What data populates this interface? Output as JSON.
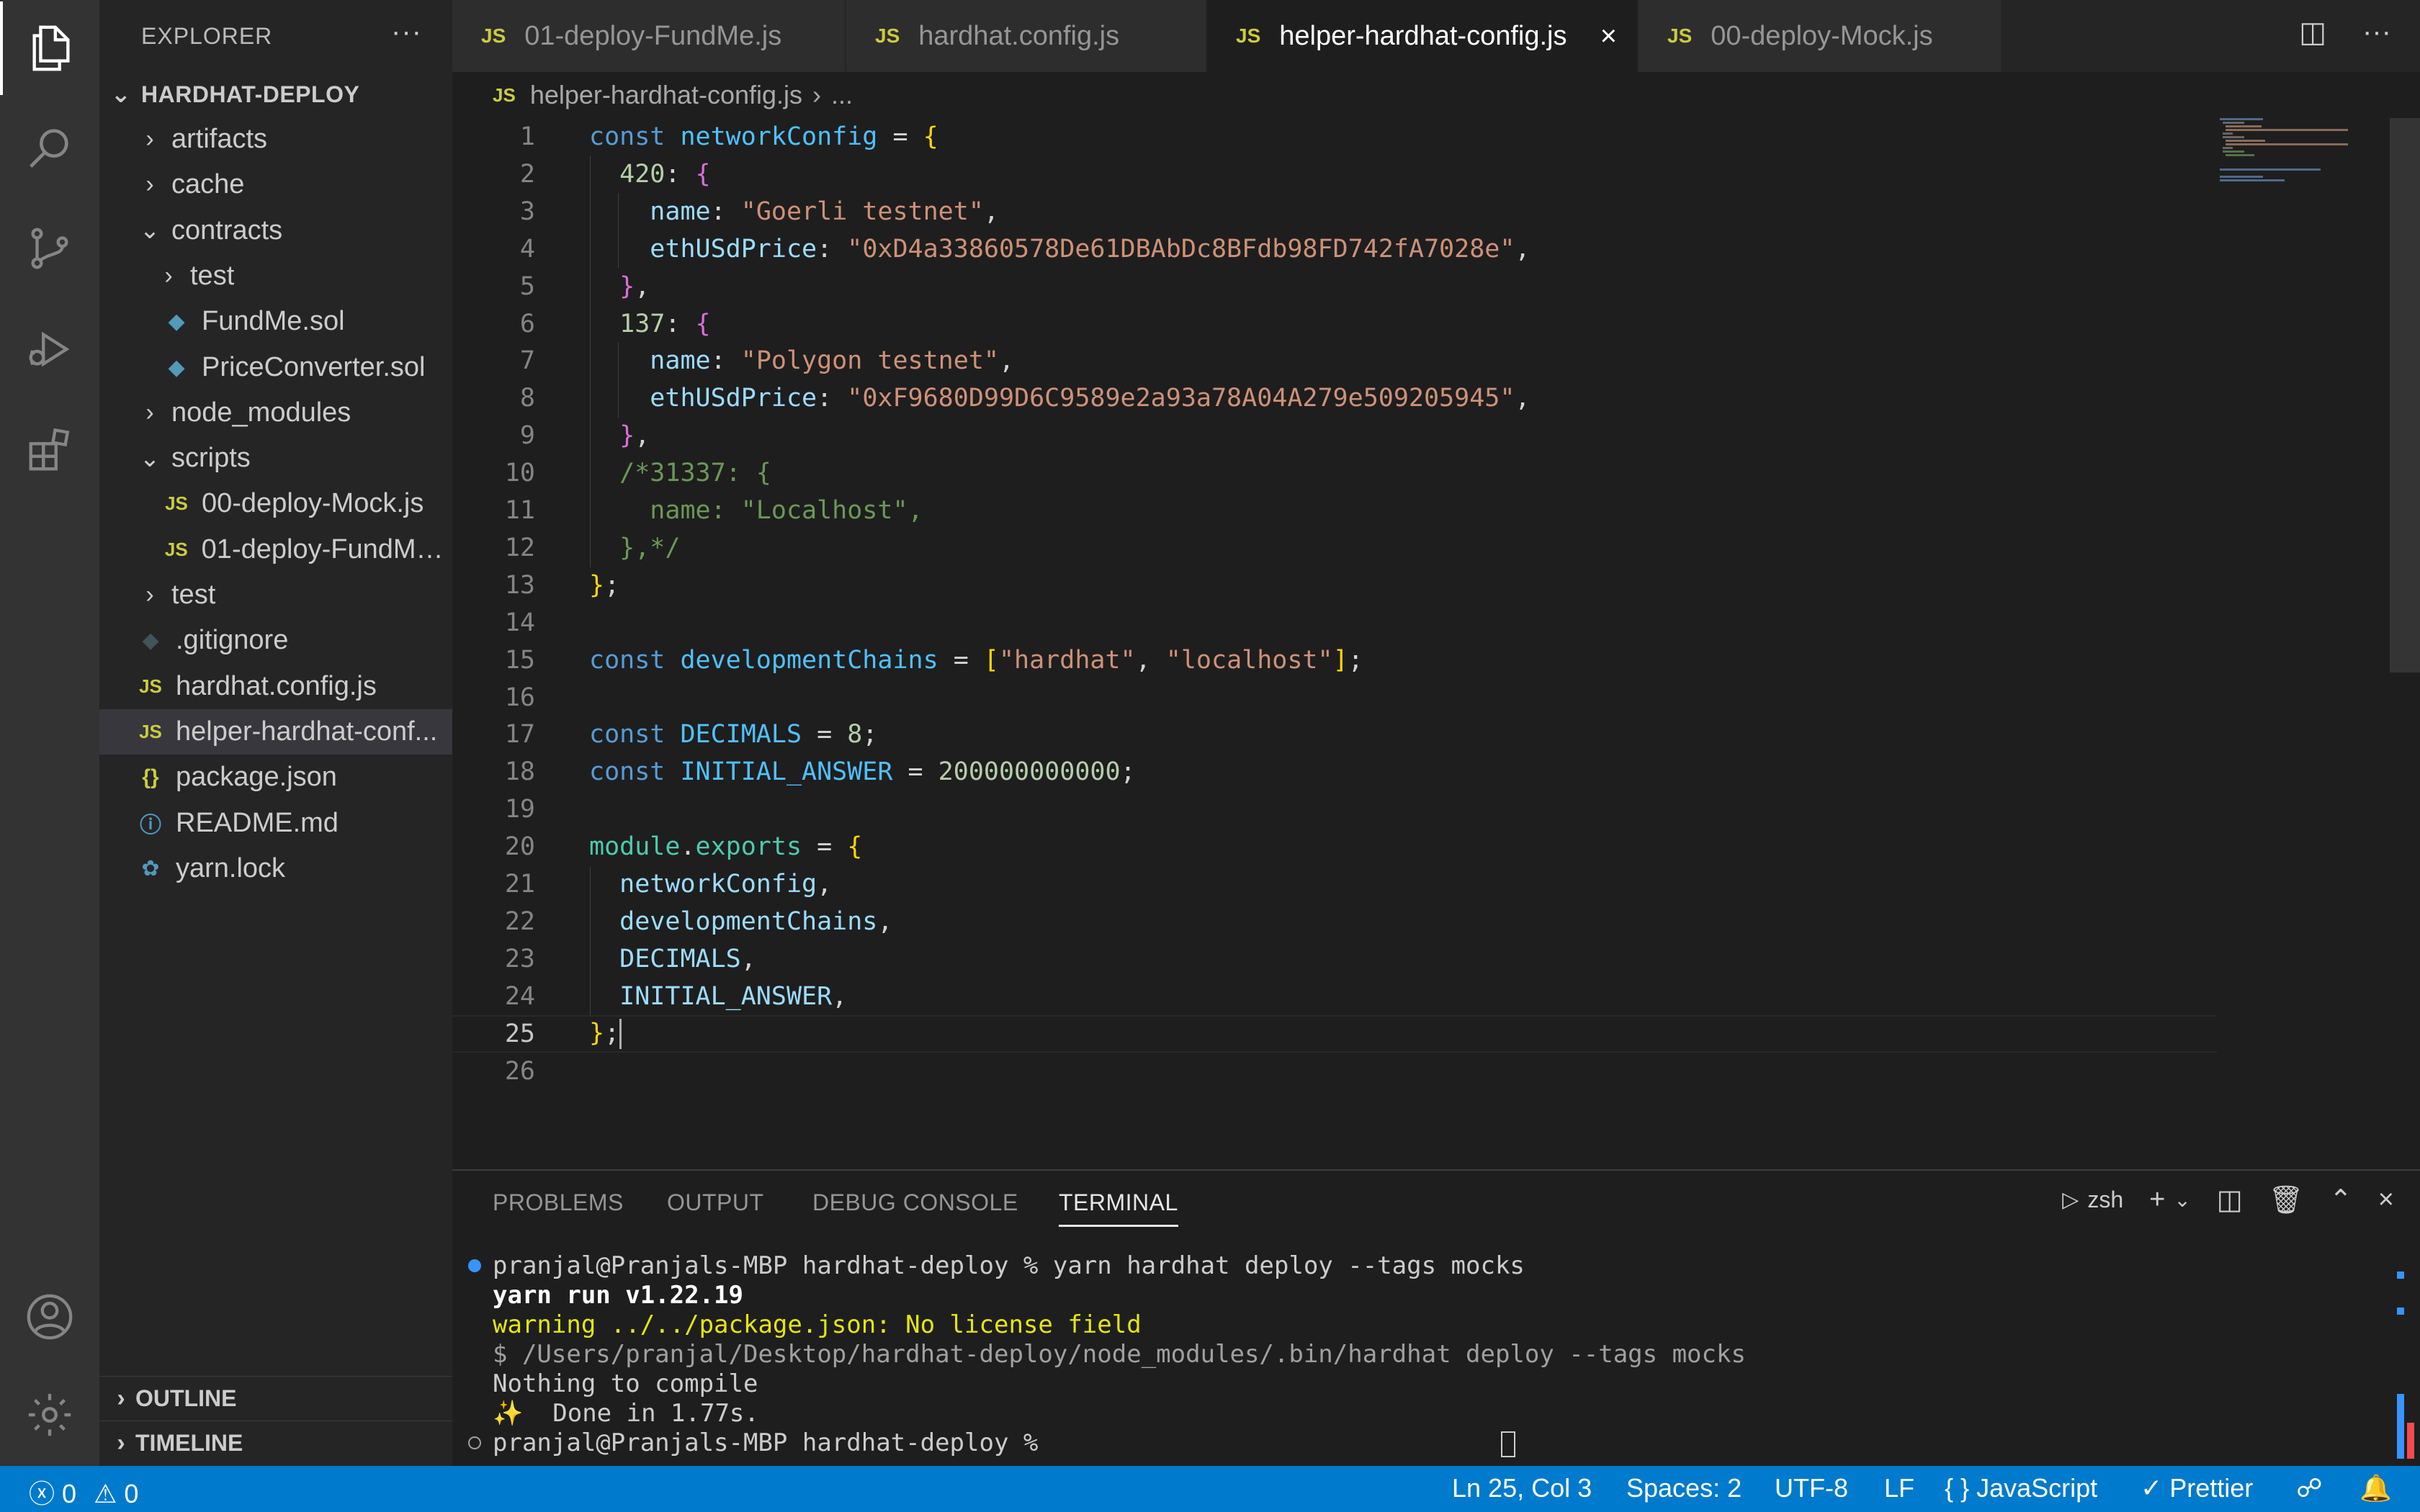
{
  "explorer": {
    "title": "EXPLORER",
    "more": "···",
    "project": "HARDHAT-DEPLOY",
    "items": [
      {
        "label": "artifacts",
        "type": "folder",
        "open": false,
        "depth": 0
      },
      {
        "label": "cache",
        "type": "folder",
        "open": false,
        "depth": 0
      },
      {
        "label": "contracts",
        "type": "folder",
        "open": true,
        "depth": 0
      },
      {
        "label": "test",
        "type": "folder",
        "open": false,
        "depth": 1
      },
      {
        "label": "FundMe.sol",
        "type": "sol",
        "depth": 1
      },
      {
        "label": "PriceConverter.sol",
        "type": "sol",
        "depth": 1
      },
      {
        "label": "node_modules",
        "type": "folder",
        "open": false,
        "depth": 0
      },
      {
        "label": "scripts",
        "type": "folder",
        "open": true,
        "depth": 0
      },
      {
        "label": "00-deploy-Mock.js",
        "type": "js",
        "depth": 1
      },
      {
        "label": "01-deploy-FundMe...",
        "type": "js",
        "depth": 1
      },
      {
        "label": "test",
        "type": "folder",
        "open": false,
        "depth": 0
      },
      {
        "label": ".gitignore",
        "type": "git",
        "depth": 0
      },
      {
        "label": "hardhat.config.js",
        "type": "js",
        "depth": 0
      },
      {
        "label": "helper-hardhat-conf...",
        "type": "js",
        "depth": 0,
        "selected": true
      },
      {
        "label": "package.json",
        "type": "json",
        "depth": 0
      },
      {
        "label": "README.md",
        "type": "info",
        "depth": 0
      },
      {
        "label": "yarn.lock",
        "type": "yarn",
        "depth": 0
      }
    ],
    "outline": "OUTLINE",
    "timeline": "TIMELINE"
  },
  "tabs": [
    {
      "label": "01-deploy-FundMe.js",
      "active": false
    },
    {
      "label": "hardhat.config.js",
      "active": false
    },
    {
      "label": "helper-hardhat-config.js",
      "active": true
    },
    {
      "label": "00-deploy-Mock.js",
      "active": false
    }
  ],
  "tab_icon": "JS",
  "breadcrumb": {
    "file": "helper-hardhat-config.js",
    "rest": "..."
  },
  "editor": {
    "lines": [
      [
        [
          "kw",
          "const "
        ],
        [
          "var",
          "networkConfig"
        ],
        [
          "op",
          " = "
        ],
        [
          "br1",
          "{"
        ]
      ],
      [
        [
          "op",
          "  "
        ],
        [
          "num",
          "420"
        ],
        [
          "op",
          ": "
        ],
        [
          "br2",
          "{"
        ]
      ],
      [
        [
          "op",
          "    "
        ],
        [
          "prop",
          "name"
        ],
        [
          "op",
          ": "
        ],
        [
          "str",
          "\"Goerli testnet\""
        ],
        [
          "op",
          ","
        ]
      ],
      [
        [
          "op",
          "    "
        ],
        [
          "prop",
          "ethUSdPrice"
        ],
        [
          "op",
          ": "
        ],
        [
          "str",
          "\"0xD4a33860578De61DBAbDc8BFdb98FD742fA7028e\""
        ],
        [
          "op",
          ","
        ]
      ],
      [
        [
          "op",
          "  "
        ],
        [
          "br2",
          "}"
        ],
        [
          "op",
          ","
        ]
      ],
      [
        [
          "op",
          "  "
        ],
        [
          "num",
          "137"
        ],
        [
          "op",
          ": "
        ],
        [
          "br2",
          "{"
        ]
      ],
      [
        [
          "op",
          "    "
        ],
        [
          "prop",
          "name"
        ],
        [
          "op",
          ": "
        ],
        [
          "str",
          "\"Polygon testnet\""
        ],
        [
          "op",
          ","
        ]
      ],
      [
        [
          "op",
          "    "
        ],
        [
          "prop",
          "ethUSdPrice"
        ],
        [
          "op",
          ": "
        ],
        [
          "str",
          "\"0xF9680D99D6C9589e2a93a78A04A279e509205945\""
        ],
        [
          "op",
          ","
        ]
      ],
      [
        [
          "op",
          "  "
        ],
        [
          "br2",
          "}"
        ],
        [
          "op",
          ","
        ]
      ],
      [
        [
          "op",
          "  "
        ],
        [
          "cmt",
          "/*31337: {"
        ]
      ],
      [
        [
          "op",
          "    "
        ],
        [
          "cmt",
          "name: \"Localhost\","
        ]
      ],
      [
        [
          "op",
          "  "
        ],
        [
          "cmt",
          "},*/"
        ]
      ],
      [
        [
          "br1",
          "}"
        ],
        [
          "op",
          ";"
        ]
      ],
      [],
      [
        [
          "kw",
          "const "
        ],
        [
          "var",
          "developmentChains"
        ],
        [
          "op",
          " = "
        ],
        [
          "br1",
          "["
        ],
        [
          "str",
          "\"hardhat\""
        ],
        [
          "op",
          ", "
        ],
        [
          "str",
          "\"localhost\""
        ],
        [
          "br1",
          "]"
        ],
        [
          "op",
          ";"
        ]
      ],
      [],
      [
        [
          "kw",
          "const "
        ],
        [
          "var",
          "DECIMALS"
        ],
        [
          "op",
          " = "
        ],
        [
          "num",
          "8"
        ],
        [
          "op",
          ";"
        ]
      ],
      [
        [
          "kw",
          "const "
        ],
        [
          "var",
          "INITIAL_ANSWER"
        ],
        [
          "op",
          " = "
        ],
        [
          "num",
          "200000000000"
        ],
        [
          "op",
          ";"
        ]
      ],
      [],
      [
        [
          "mod",
          "module"
        ],
        [
          "op",
          "."
        ],
        [
          "mod",
          "exports"
        ],
        [
          "op",
          " = "
        ],
        [
          "br1",
          "{"
        ]
      ],
      [
        [
          "op",
          "  "
        ],
        [
          "prop",
          "networkConfig"
        ],
        [
          "op",
          ","
        ]
      ],
      [
        [
          "op",
          "  "
        ],
        [
          "prop",
          "developmentChains"
        ],
        [
          "op",
          ","
        ]
      ],
      [
        [
          "op",
          "  "
        ],
        [
          "prop",
          "DECIMALS"
        ],
        [
          "op",
          ","
        ]
      ],
      [
        [
          "op",
          "  "
        ],
        [
          "prop",
          "INITIAL_ANSWER"
        ],
        [
          "op",
          ","
        ]
      ],
      [
        [
          "br1",
          "}"
        ],
        [
          "op",
          ";"
        ]
      ],
      []
    ],
    "current_line": 25
  },
  "panel": {
    "tabs": [
      "PROBLEMS",
      "OUTPUT",
      "DEBUG CONSOLE",
      "TERMINAL"
    ],
    "active_tab": "TERMINAL",
    "shell": "zsh",
    "terminal": [
      {
        "text": "pranjal@Pranjals-MBP hardhat-deploy % yarn hardhat deploy --tags mocks",
        "color": "#cccccc",
        "dot": "filled"
      },
      {
        "text": "yarn run v1.22.19",
        "color": "#ffffff",
        "bold": true
      },
      {
        "text": "warning ../../package.json: No license field",
        "color": "#e5e510",
        "mixed": true
      },
      {
        "text": "$ /Users/pranjal/Desktop/hardhat-deploy/node_modules/.bin/hardhat deploy --tags mocks",
        "color": "#a0a0a0"
      },
      {
        "text": "Nothing to compile",
        "color": "#cccccc"
      },
      {
        "text": "✨  Done in 1.77s.",
        "color": "#cccccc"
      },
      {
        "text": "pranjal@Pranjals-MBP hardhat-deploy % ",
        "color": "#cccccc",
        "dot": "empty",
        "cursor": true
      }
    ]
  },
  "status": {
    "errors": "0",
    "warnings": "0",
    "position": "Ln 25, Col 3",
    "spaces": "Spaces: 2",
    "encoding": "UTF-8",
    "eol": "LF",
    "language": "JavaScript",
    "formatter": "Prettier"
  },
  "colors": {
    "status_bar": "#007acc",
    "activity_bar": "#333333",
    "sidebar": "#252526",
    "editor": "#1e1e1e"
  }
}
